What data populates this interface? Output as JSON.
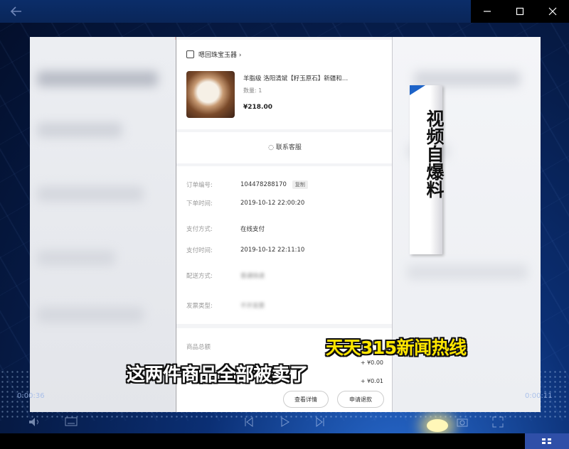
{
  "window": {
    "back_icon": "arrow-left-icon",
    "minimize_icon": "minimize-icon",
    "maximize_icon": "maximize-icon",
    "close_icon": "close-icon"
  },
  "video": {
    "vertical_badge": "视频自爆料",
    "caption_brand": "天天315新闻热线",
    "caption_subtitle": "这两件商品全部被卖了",
    "time_current": "0:00:36",
    "time_total": "0:00:11"
  },
  "order": {
    "shop_name": "嗯回珠宝玉器 ›",
    "product_title": "羊脂级 洛阳清斌【籽玉原石】新疆和…",
    "product_qty": "数量: 1",
    "product_price": "¥218.00",
    "service_label": "联系客服",
    "rows": [
      {
        "key": "订单编号:",
        "value": "104478288170",
        "tag": "复制"
      },
      {
        "key": "下单时间:",
        "value": "2019-10-12 22:00:20"
      },
      {
        "key": "支付方式:",
        "value": "在线支付"
      },
      {
        "key": "支付时间:",
        "value": "2019-10-12 22:11:10"
      },
      {
        "key": "配送方式:",
        "value": "普通快递"
      },
      {
        "key": "发票类型:",
        "value": "不开发票"
      }
    ],
    "goods_label": "商品总额",
    "amount_1": "+ ¥0.00",
    "amount_2": "+ ¥0.01",
    "btn_logistics": "查看详情",
    "btn_refund": "申请退款"
  },
  "colors": {
    "background": "#0b2f74",
    "caption_yellow": "#ffe600",
    "badge_accent": "#1d63c8"
  }
}
